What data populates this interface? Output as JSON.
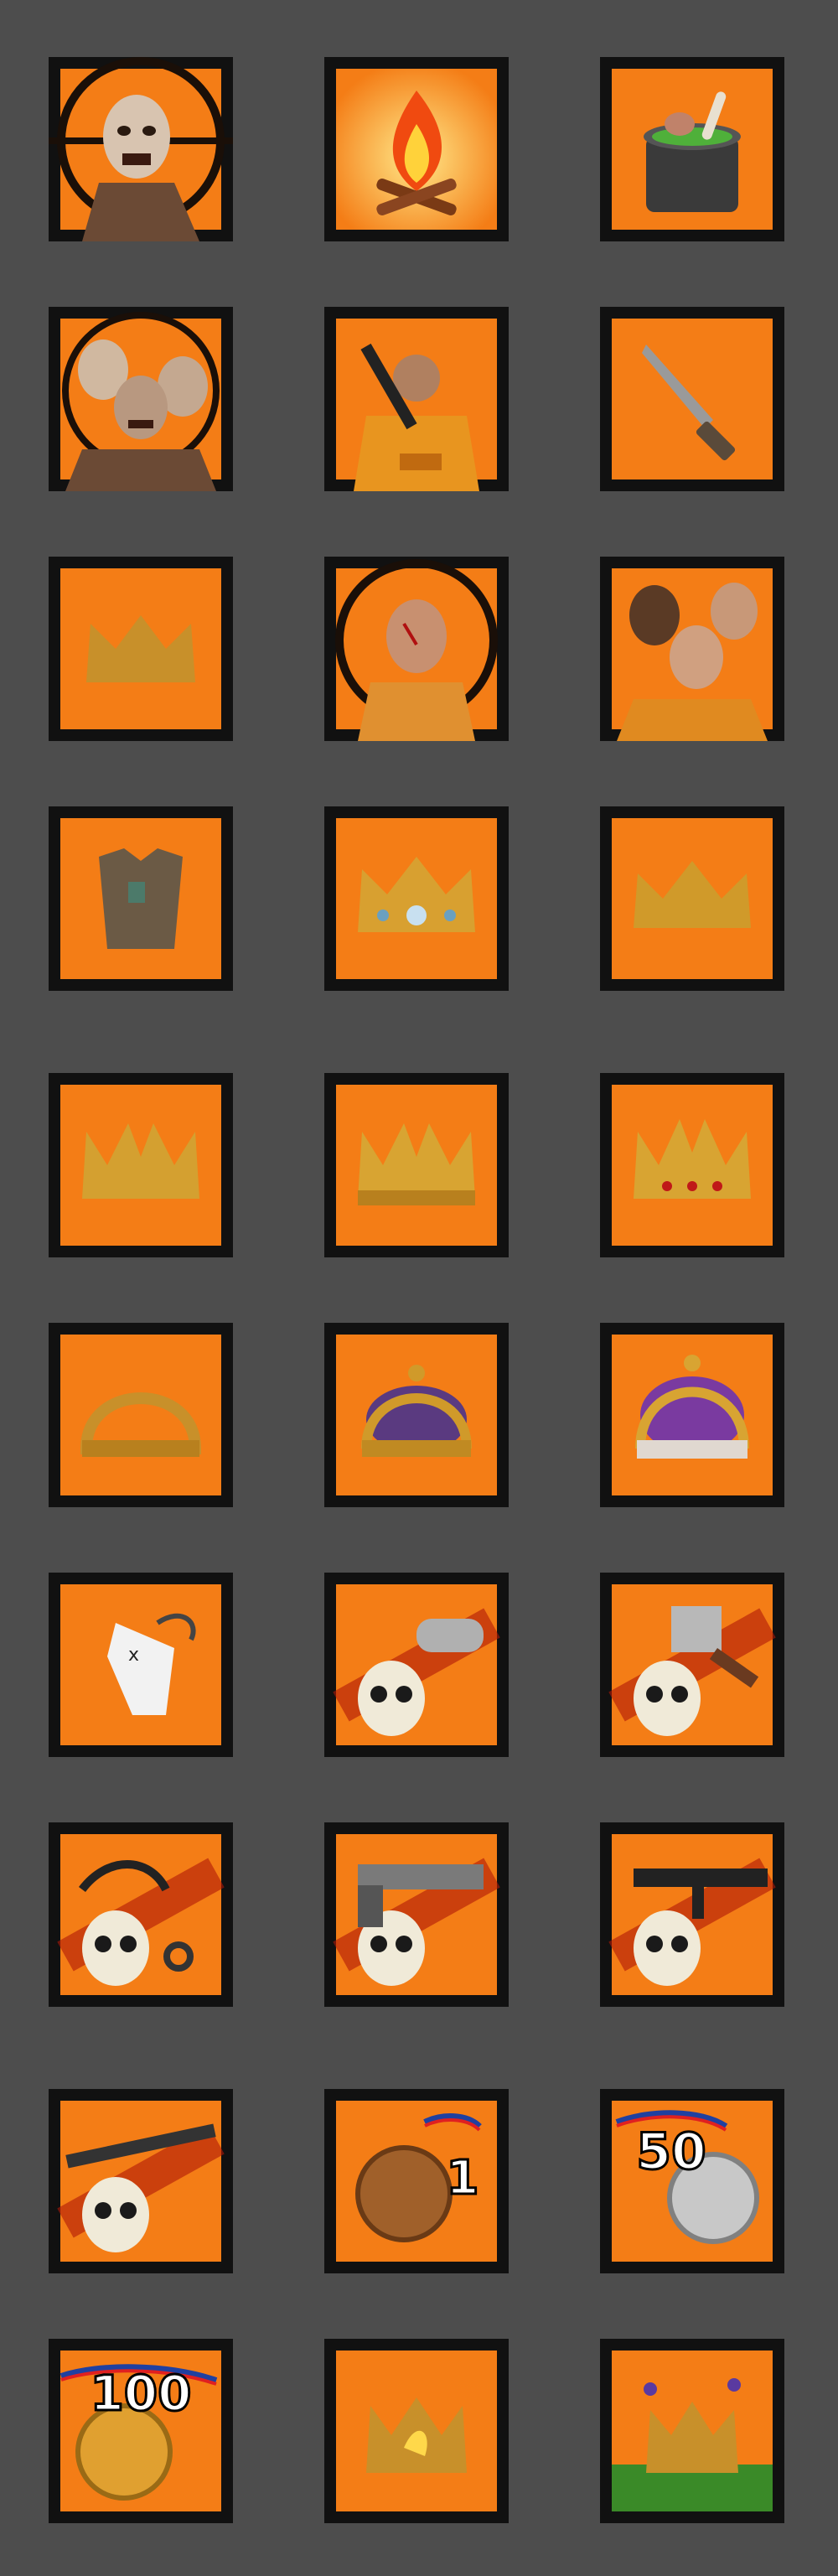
{
  "colors": {
    "background": "#4d4d4d",
    "tile_orange": "#f47d16",
    "tile_border": "#111111"
  },
  "icons": [
    {
      "name": "zombie-prisoner-icon"
    },
    {
      "name": "campfire-icon"
    },
    {
      "name": "cooking-pot-icon"
    },
    {
      "name": "zombie-horde-icon"
    },
    {
      "name": "prisoner-with-rifle-icon"
    },
    {
      "name": "knife-icon"
    },
    {
      "name": "broken-crown-icon"
    },
    {
      "name": "wounded-prisoner-icon"
    },
    {
      "name": "prisoner-group-icon"
    },
    {
      "name": "ragged-shirt-icon"
    },
    {
      "name": "jeweled-crown-icon"
    },
    {
      "name": "golden-crown-icon"
    },
    {
      "name": "spiked-crown-icon"
    },
    {
      "name": "ornate-crown-icon"
    },
    {
      "name": "jeweled-spiked-crown-icon"
    },
    {
      "name": "arched-crown-icon"
    },
    {
      "name": "royal-crown-icon"
    },
    {
      "name": "purple-royal-crown-icon"
    },
    {
      "name": "dead-goat-icon"
    },
    {
      "name": "skull-brass-knuckles-icon"
    },
    {
      "name": "skull-cleaver-icon"
    },
    {
      "name": "skull-karambit-icon"
    },
    {
      "name": "skull-pistol-icon"
    },
    {
      "name": "skull-smg-icon"
    },
    {
      "name": "skull-rifle-icon"
    },
    {
      "name": "bronze-medal-icon",
      "label": "1"
    },
    {
      "name": "silver-medal-icon",
      "label": "50"
    },
    {
      "name": "gold-medal-icon",
      "label": "100"
    },
    {
      "name": "burning-crown-icon"
    },
    {
      "name": "crown-in-grass-icon"
    }
  ]
}
